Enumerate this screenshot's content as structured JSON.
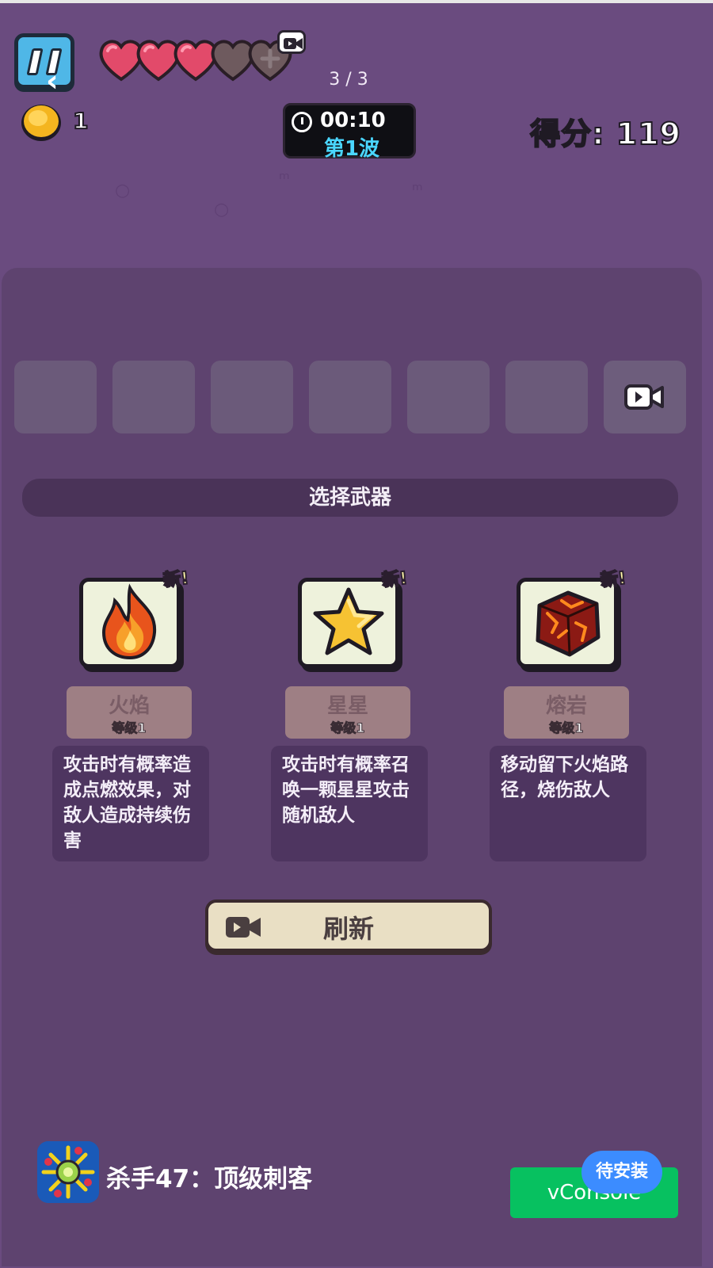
{
  "hud": {
    "page_indicator": "3 / 3",
    "coins": "1",
    "timer": "00:10",
    "wave": "第1波",
    "score": "得分: 119",
    "hearts_full": 3,
    "hearts_total": 5
  },
  "panel": {
    "section_title": "选择武器",
    "slot_count": 6,
    "cards": [
      {
        "new_tag": "新!",
        "name": "火焰",
        "level": "等级1",
        "desc": "攻击时有概率造成点燃效果，对敌人造成持续伤害",
        "icon": "flame-icon"
      },
      {
        "new_tag": "新!",
        "name": "星星",
        "level": "等级1",
        "desc": "攻击时有概率召唤一颗星星攻击随机敌人",
        "icon": "star-icon"
      },
      {
        "new_tag": "新!",
        "name": "熔岩",
        "level": "等级1",
        "desc": "移动留下火焰路径，烧伤敌人",
        "icon": "lava-rock-icon"
      }
    ],
    "refresh_label": "刷新"
  },
  "ad": {
    "title": "杀手47：顶级刺客",
    "install_badge": "待安装",
    "vconsole": "vConsole"
  },
  "colors": {
    "background": "#6a4b7f",
    "panel": "#5e436f",
    "heart_full": "#e24a6a",
    "heart_empty": "#6e5a5e",
    "wave_text": "#4ad6ff",
    "vconsole": "#07c160",
    "install_badge": "#3c8cff"
  }
}
